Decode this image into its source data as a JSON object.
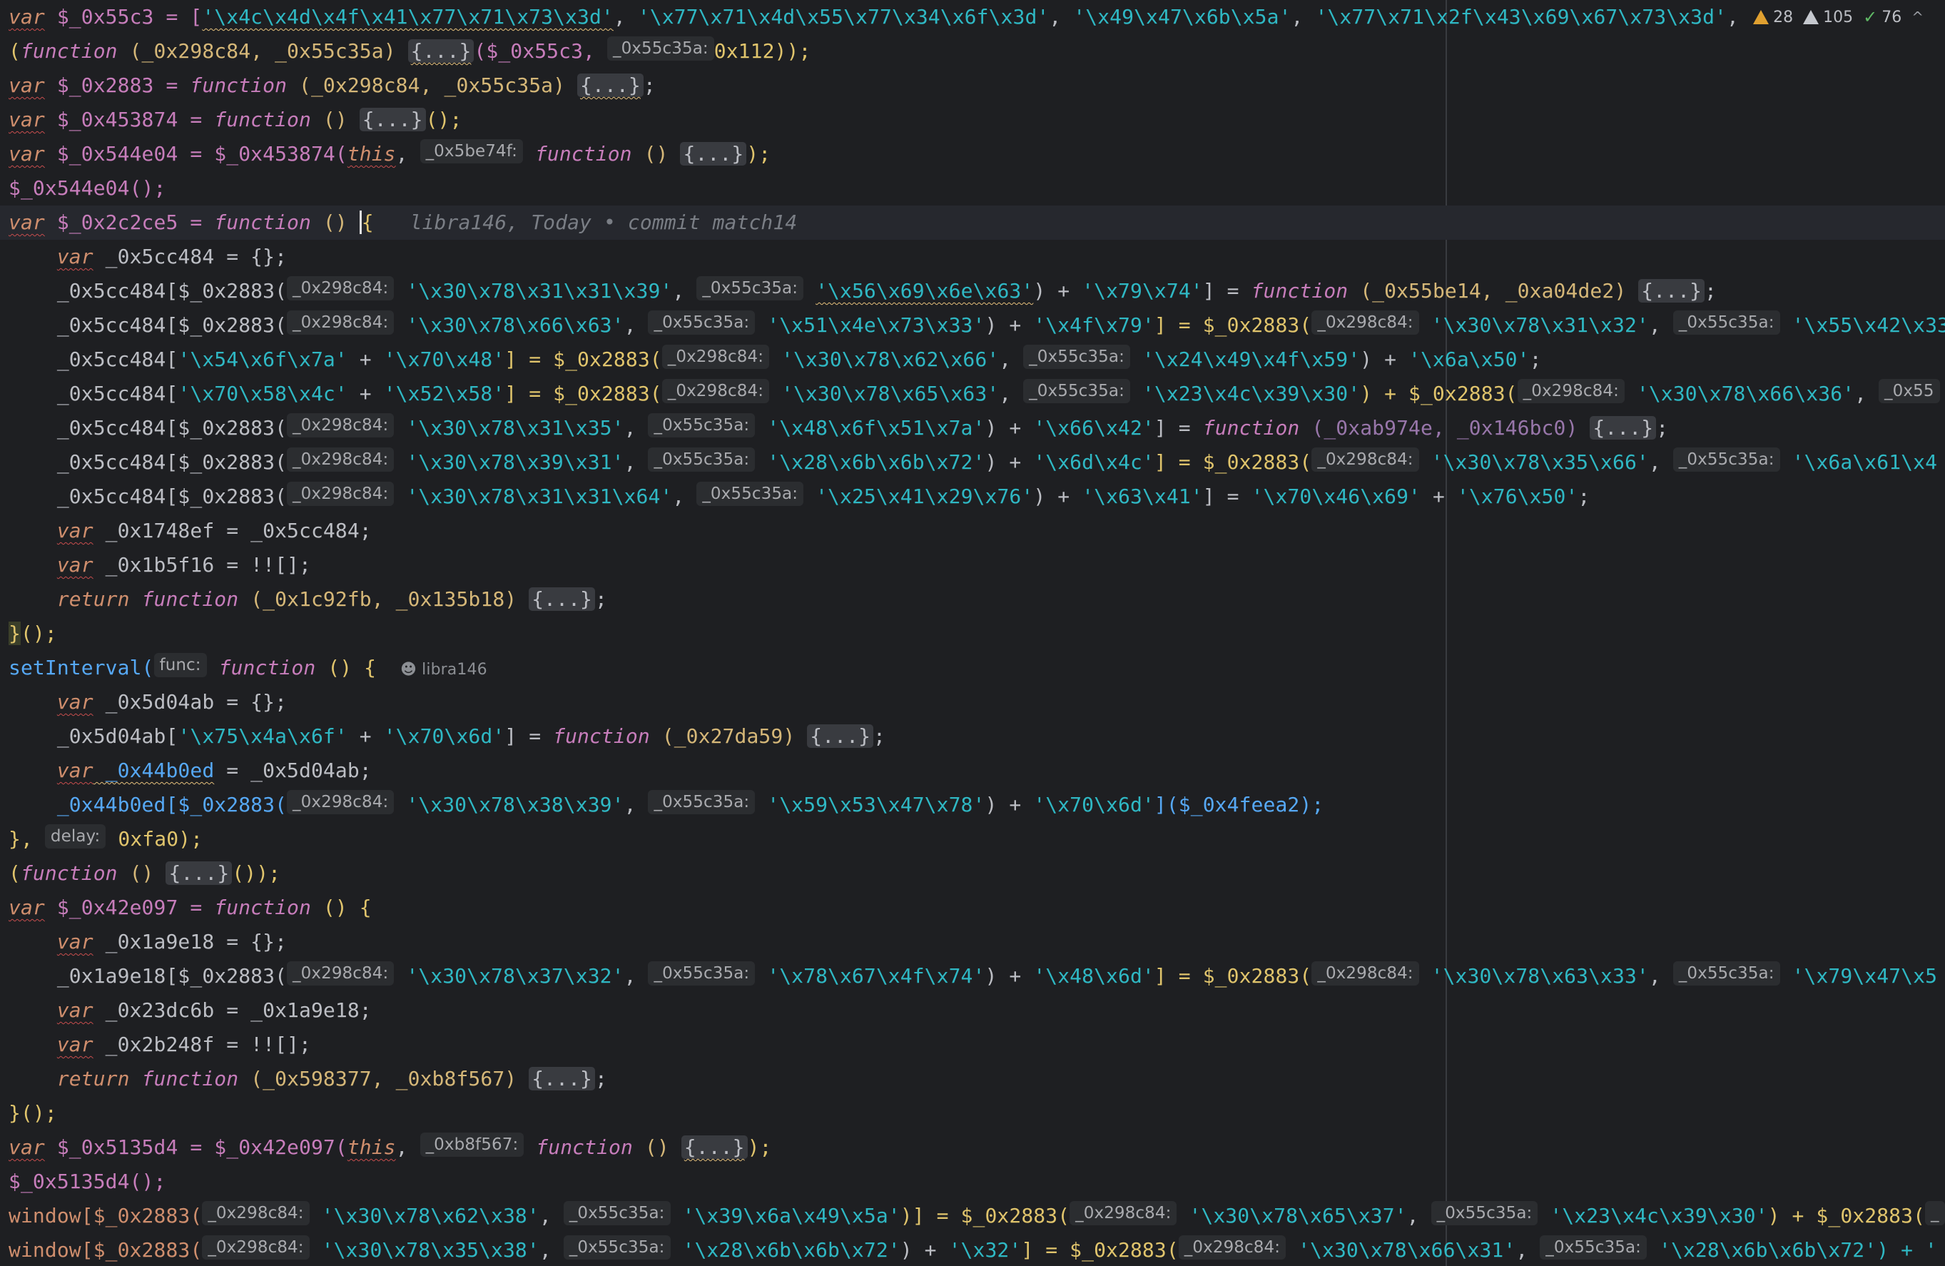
{
  "status": {
    "errors": "28",
    "warnings": "105",
    "ok": "76",
    "chevron": "^"
  },
  "git_blame": {
    "author": "libra146",
    "inline": "libra146, Today • commit match14"
  },
  "hints": {
    "p1": "_0x298c84:",
    "p2": "_0x55c35a:",
    "p_5be": "_0x5be74f:",
    "p_b8f": "_0xb8f567:",
    "func": "func:",
    "delay": "delay:"
  },
  "code": {
    "l1_a": "var",
    "l1_b": " $_0x55c3 = [",
    "l1_c": "'\\x4c\\x4d\\x4f\\x41\\x77\\x71\\x73\\x3d'",
    "l1_d": ", ",
    "l1_e": "'\\x77\\x71\\x4d\\x55\\x77\\x34\\x6f\\x3d'",
    "l1_f": ", ",
    "l1_g": "'\\x49\\x47\\x6b\\x5a'",
    "l1_h": ", ",
    "l1_i": "'\\x77\\x71\\x2f\\x43\\x69\\x67\\x73\\x3d'",
    "l1_j": ", ",
    "l2_a": "(",
    "l2_b": "function",
    "l2_c": " (_0x298c84, _0x55c35a) ",
    "l2_d": "{...}",
    "l2_e": "($_0x55c3, ",
    "l2_f": "0x112",
    "l2_g": "));",
    "l3_a": "var",
    "l3_b": " $_0x2883 = ",
    "l3_c": "function",
    "l3_d": " (_0x298c84, _0x55c35a) ",
    "l3_e": "{...}",
    "l3_f": ";",
    "l4_a": "var",
    "l4_b": " $_0x453874 = ",
    "l4_c": "function",
    "l4_d": " () ",
    "l4_e": "{...}",
    "l4_f": "();",
    "l5_a": "var",
    "l5_b": " $_0x544e04 = $_0x453874(",
    "l5_c": "this",
    "l5_d": ", ",
    "l5_e": "function",
    "l5_f": " () ",
    "l5_g": "{...}",
    "l5_h": ");",
    "l6": "$_0x544e04();",
    "l7_a": "var",
    "l7_b": " $_0x2c2ce5 = ",
    "l7_c": "function",
    "l7_d": " () ",
    "l7_e": "{",
    "l8_a": "var",
    "l8_b": " _0x5cc484 = {};",
    "l9_a": "_0x5cc484[$_0x2883(",
    "l9_b": "'\\x30\\x78\\x31\\x31\\x39'",
    "l9_c": ", ",
    "l9_d": "'\\x56\\x69\\x6e\\x63'",
    "l9_e": ") + ",
    "l9_f": "'\\x79\\x74'",
    "l9_g": "] = ",
    "l9_h": "function",
    "l9_i": " (_0x55be14, _0xa04de2) ",
    "l9_j": "{...}",
    "l9_k": ";",
    "l10_a": "_0x5cc484[$_0x2883(",
    "l10_b": "'\\x30\\x78\\x66\\x63'",
    "l10_c": ", ",
    "l10_d": "'\\x51\\x4e\\x73\\x33'",
    "l10_e": ") + ",
    "l10_f": "'\\x4f\\x79'",
    "l10_g": "] = $_0x2883(",
    "l10_h": "'\\x30\\x78\\x31\\x32'",
    "l10_i": ", ",
    "l10_j": "'\\x55\\x42\\x33",
    "l11_a": "_0x5cc484[",
    "l11_b": "'\\x54\\x6f\\x7a'",
    "l11_c": " + ",
    "l11_d": "'\\x70\\x48'",
    "l11_e": "] = $_0x2883(",
    "l11_f": "'\\x30\\x78\\x62\\x66'",
    "l11_g": ", ",
    "l11_h": "'\\x24\\x49\\x4f\\x59'",
    "l11_i": ") + ",
    "l11_j": "'\\x6a\\x50'",
    "l11_k": ";",
    "l12_a": "_0x5cc484[",
    "l12_b": "'\\x70\\x58\\x4c'",
    "l12_c": " + ",
    "l12_d": "'\\x52\\x58'",
    "l12_e": "] = $_0x2883(",
    "l12_f": "'\\x30\\x78\\x65\\x63'",
    "l12_g": ", ",
    "l12_h": "'\\x23\\x4c\\x39\\x30'",
    "l12_i": ") + $_0x2883(",
    "l12_j": "'\\x30\\x78\\x66\\x36'",
    "l12_k": ", ",
    "l12_l": "_0x55",
    "l13_a": "_0x5cc484[$_0x2883(",
    "l13_b": "'\\x30\\x78\\x31\\x35'",
    "l13_c": ", ",
    "l13_d": "'\\x48\\x6f\\x51\\x7a'",
    "l13_e": ") + ",
    "l13_f": "'\\x66\\x42'",
    "l13_g": "] = ",
    "l13_h": "function",
    "l13_i": " (_0xab974e, _0x146bc0) ",
    "l13_j": "{...}",
    "l13_k": ";",
    "l14_a": "_0x5cc484[$_0x2883(",
    "l14_b": "'\\x30\\x78\\x39\\x31'",
    "l14_c": ", ",
    "l14_d": "'\\x28\\x6b\\x6b\\x72'",
    "l14_e": ") + ",
    "l14_f": "'\\x6d\\x4c'",
    "l14_g": "] = $_0x2883(",
    "l14_h": "'\\x30\\x78\\x35\\x66'",
    "l14_i": ", ",
    "l14_j": "'\\x6a\\x61\\x4",
    "l15_a": "_0x5cc484[$_0x2883(",
    "l15_b": "'\\x30\\x78\\x31\\x31\\x64'",
    "l15_c": ", ",
    "l15_d": "'\\x25\\x41\\x29\\x76'",
    "l15_e": ") + ",
    "l15_f": "'\\x63\\x41'",
    "l15_g": "] = ",
    "l15_h": "'\\x70\\x46\\x69'",
    "l15_i": " + ",
    "l15_j": "'\\x76\\x50'",
    "l15_k": ";",
    "l16_a": "var",
    "l16_b": " _0x1748ef = _0x5cc484;",
    "l17_a": "var",
    "l17_b": " _0x1b5f16 = !![];",
    "l18_a": "return",
    "l18_b": " ",
    "l18_c": "function",
    "l18_d": " (_0x1c92fb, _0x135b18) ",
    "l18_e": "{...}",
    "l18_f": ";",
    "l19_a": "}",
    "l19_b": "();",
    "l20_a": "setInterval(",
    "l20_b": "function",
    "l20_c": " () {",
    "l21_a": "var",
    "l21_b": " _0x5d04ab = {};",
    "l22_a": "_0x5d04ab[",
    "l22_b": "'\\x75\\x4a\\x6f'",
    "l22_c": " + ",
    "l22_d": "'\\x70\\x6d'",
    "l22_e": "] = ",
    "l22_f": "function",
    "l22_g": " (_0x27da59) ",
    "l22_h": "{...}",
    "l22_i": ";",
    "l23_a": "var",
    "l23_b": " _0x44b0ed",
    "l23_c": " = _0x5d04ab;",
    "l24_a": "_0x44b0ed[$_0x2883(",
    "l24_b": "'\\x30\\x78\\x38\\x39'",
    "l24_c": ", ",
    "l24_d": "'\\x59\\x53\\x47\\x78'",
    "l24_e": ") + ",
    "l24_f": "'\\x70\\x6d'",
    "l24_g": "]($_0x4feea2);",
    "l25_a": "}, ",
    "l25_b": "0xfa0",
    "l25_c": ");",
    "l26_a": "(",
    "l26_b": "function",
    "l26_c": " () ",
    "l26_d": "{...}",
    "l26_e": "());",
    "l27_a": "var",
    "l27_b": " $_0x42e097 = ",
    "l27_c": "function",
    "l27_d": " () {",
    "l28_a": "var",
    "l28_b": " _0x1a9e18 = {};",
    "l29_a": "_0x1a9e18[$_0x2883(",
    "l29_b": "'\\x30\\x78\\x37\\x32'",
    "l29_c": ", ",
    "l29_d": "'\\x78\\x67\\x4f\\x74'",
    "l29_e": ") + ",
    "l29_f": "'\\x48\\x6d'",
    "l29_g": "] = $_0x2883(",
    "l29_h": "'\\x30\\x78\\x63\\x33'",
    "l29_i": ", ",
    "l29_j": "'\\x79\\x47\\x5",
    "l30_a": "var",
    "l30_b": " _0x23dc6b = _0x1a9e18;",
    "l31_a": "var",
    "l31_b": " _0x2b248f = !![];",
    "l32_a": "return",
    "l32_b": " ",
    "l32_c": "function",
    "l32_d": " (_0x598377, _0xb8f567) ",
    "l32_e": "{...}",
    "l32_f": ";",
    "l33_a": "}",
    "l33_b": "();",
    "l34_a": "var",
    "l34_b": " $_0x5135d4 = $_0x42e097(",
    "l34_c": "this",
    "l34_d": ", ",
    "l34_e": "function",
    "l34_f": " () ",
    "l34_g": "{...}",
    "l34_h": ");",
    "l35": "$_0x5135d4();",
    "l36_a": "window[$_0x2883(",
    "l36_b": "'\\x30\\x78\\x62\\x38'",
    "l36_c": ", ",
    "l36_d": "'\\x39\\x6a\\x49\\x5a'",
    "l36_e": ")] = $_0x2883(",
    "l36_f": "'\\x30\\x78\\x65\\x37'",
    "l36_g": ", ",
    "l36_h": "'\\x23\\x4c\\x39\\x30'",
    "l36_i": ") + $_0x2883(",
    "l36_j": "_",
    "l37_a": "window[$_0x2883(",
    "l37_b": "'\\x30\\x78\\x35\\x38'",
    "l37_c": ", ",
    "l37_d": "'\\x28\\x6b\\x6b\\x72'",
    "l37_e": ") + ",
    "l37_f": "'\\x32'",
    "l37_g": "] = $_0x2883(",
    "l37_h": "'\\x30\\x78\\x66\\x31'",
    "l37_i": ", ",
    "l37_j": "'\\x28\\x6b\\x6b\\x72'",
    "l37_k": ") + '"
  },
  "colors": {
    "background": "#1e1f22",
    "keyword": "#cf8e6d",
    "function_keyword": "#c77dbb",
    "string": "#2fb8c4",
    "number": "#e0c46c",
    "warning": "#e0a030"
  },
  "icons": {
    "errors": "warning-triangle-icon",
    "warnings": "warning-triangle-grey-icon",
    "ok": "check-icon",
    "collapse": "chevron-up-icon",
    "author": "person-icon"
  }
}
